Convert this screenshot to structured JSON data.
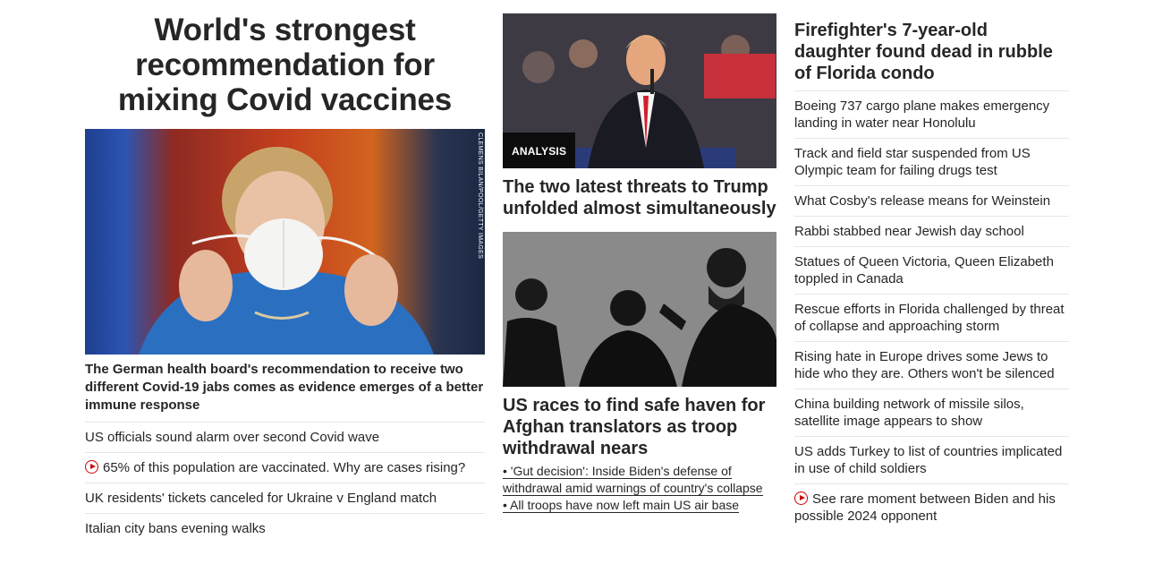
{
  "lead": {
    "title": "World's strongest recommendation for mixing Covid vaccines",
    "image_credit": "CLEMENS BILAN/POOL/GETTY IMAGES",
    "caption": "The German health board's recommendation to receive two different Covid-19 jabs comes as evidence emerges of a better immune response",
    "links": [
      {
        "text": "US officials sound alarm over second Covid wave",
        "video": false
      },
      {
        "text": "65% of this population are vaccinated. Why are cases rising?",
        "video": true
      },
      {
        "text": "UK residents' tickets canceled for Ukraine v England match",
        "video": false
      },
      {
        "text": "Italian city bans evening walks",
        "video": false
      }
    ]
  },
  "middle": {
    "story1": {
      "badge": "ANALYSIS",
      "headline": "The two latest threats to Trump unfolded almost simultaneously"
    },
    "story2": {
      "headline": "US races to find safe haven for Afghan translators as troop withdrawal nears",
      "sublinks": [
        "• 'Gut decision': Inside Biden's defense of withdrawal amid warnings of country's collapse",
        "• All troops have now left main US air base"
      ]
    }
  },
  "right": {
    "headline": "Firefighter's 7-year-old daughter found dead in rubble of Florida condo",
    "links": [
      {
        "text": "Boeing 737 cargo plane makes emergency landing in water near Honolulu",
        "video": false
      },
      {
        "text": "Track and field star suspended from US Olympic team for failing drugs test",
        "video": false
      },
      {
        "text": "What Cosby's release means for Weinstein",
        "video": false
      },
      {
        "text": "Rabbi stabbed near Jewish day school",
        "video": false
      },
      {
        "text": "Statues of Queen Victoria, Queen Elizabeth toppled in Canada",
        "video": false
      },
      {
        "text": "Rescue efforts in Florida challenged by threat of collapse and approaching storm",
        "video": false
      },
      {
        "text": "Rising hate in Europe drives some Jews to hide who they are. Others won't be silenced",
        "video": false
      },
      {
        "text": "China building network of missile silos, satellite image appears to show",
        "video": false
      },
      {
        "text": "US adds Turkey to list of countries implicated in use of child soldiers",
        "video": false
      },
      {
        "text": "See rare moment between Biden and his possible 2024 opponent",
        "video": true
      }
    ]
  },
  "colors": {
    "text": "#262626",
    "accent": "#cc0000",
    "divider": "#e6e6e6",
    "badge_bg": "#0c0c0c"
  },
  "icons": {
    "video": "play-circle-icon"
  }
}
